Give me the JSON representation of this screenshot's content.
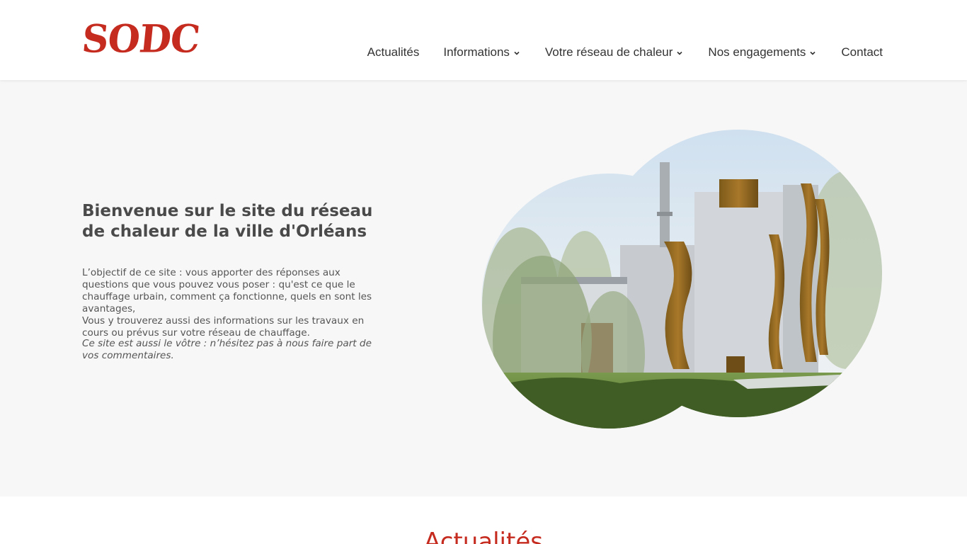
{
  "header": {
    "logo": "SODC",
    "brand_color": "#c62b1f",
    "nav": [
      {
        "label": "Actualités",
        "has_dropdown": false
      },
      {
        "label": "Informations",
        "has_dropdown": true
      },
      {
        "label": "Votre réseau de chaleur",
        "has_dropdown": true
      },
      {
        "label": "Nos engagements",
        "has_dropdown": true
      },
      {
        "label": "Contact",
        "has_dropdown": false
      }
    ]
  },
  "hero": {
    "title": "Bienvenue sur le site du réseau de chaleur de la ville d'Orléans",
    "paragraph_1": "L’objectif de ce site : vous apporter des réponses aux questions que vous pouvez vous poser : qu'est ce que le chauffage urbain, comment ça fonctionne, quels en sont les avantages,",
    "paragraph_2": "Vous y trouverez aussi des informations sur les travaux en cours ou prévus sur votre réseau de chauffage.",
    "note": "Ce site est aussi le vôtre : n’hésitez pas à nous faire part de vos commentaires.",
    "image_icon": "heating-plant-illustration"
  },
  "news": {
    "title": "Actualités"
  }
}
